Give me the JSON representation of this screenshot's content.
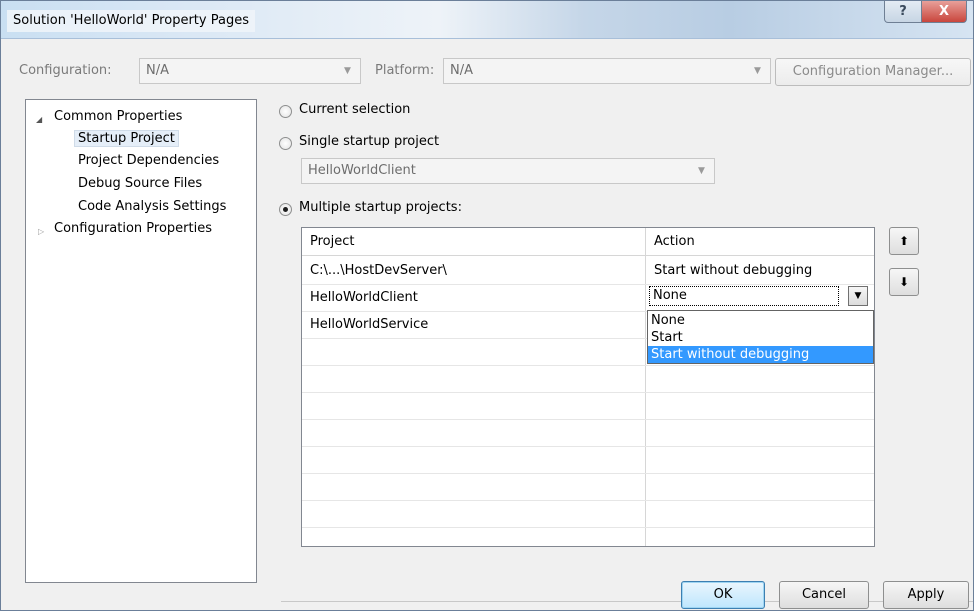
{
  "window": {
    "title": "Solution 'HelloWorld' Property Pages",
    "help_glyph": "?",
    "close_glyph": "X"
  },
  "toolbar": {
    "configuration_label": "Configuration:",
    "configuration_value": "N/A",
    "platform_label": "Platform:",
    "platform_value": "N/A",
    "config_manager_label": "Configuration Manager..."
  },
  "tree": {
    "items": [
      {
        "label": "Common Properties",
        "expanded": true
      },
      {
        "label": "Startup Project",
        "selected": true
      },
      {
        "label": "Project Dependencies"
      },
      {
        "label": "Debug Source Files"
      },
      {
        "label": "Code Analysis Settings"
      },
      {
        "label": "Configuration Properties",
        "expanded": false
      }
    ]
  },
  "startup": {
    "current_selection_label": "Current selection",
    "single_label": "Single startup project",
    "single_value": "HelloWorldClient",
    "multiple_label": "Multiple startup projects:",
    "selected_option": "multiple"
  },
  "grid": {
    "columns": [
      "Project",
      "Action"
    ],
    "rows": [
      {
        "project": "C:\\...\\HostDevServer\\",
        "action": "Start without debugging"
      },
      {
        "project": "HelloWorldClient",
        "action": "None"
      },
      {
        "project": "HelloWorldService",
        "action": ""
      }
    ],
    "dropdown_options": [
      "None",
      "Start",
      "Start without debugging"
    ],
    "highlighted_option": "Start without debugging"
  },
  "reorder": {
    "up_glyph": "⬆",
    "down_glyph": "⬇"
  },
  "buttons": {
    "ok": "OK",
    "cancel": "Cancel",
    "apply": "Apply"
  },
  "colors": {
    "selection_highlight": "#3399ff"
  }
}
